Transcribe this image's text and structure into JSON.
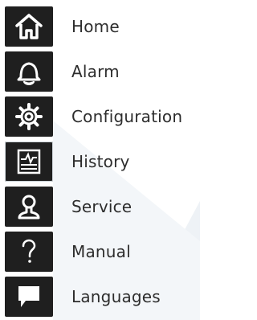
{
  "menu": {
    "items": [
      {
        "key": "home",
        "label": "Home",
        "icon": "home-icon"
      },
      {
        "key": "alarm",
        "label": "Alarm",
        "icon": "alarm-bell-icon"
      },
      {
        "key": "configuration",
        "label": "Configuration",
        "icon": "gear-icon"
      },
      {
        "key": "history",
        "label": "History",
        "icon": "history-chart-icon"
      },
      {
        "key": "service",
        "label": "Service",
        "icon": "user-icon"
      },
      {
        "key": "manual",
        "label": "Manual",
        "icon": "question-mark-icon"
      },
      {
        "key": "languages",
        "label": "Languages",
        "icon": "speech-bubble-icon"
      }
    ]
  },
  "colors": {
    "tile_background": "#1f1f1f",
    "icon": "#ffffff",
    "text": "#2d2d2d",
    "background_shape": "#eef2f6"
  }
}
